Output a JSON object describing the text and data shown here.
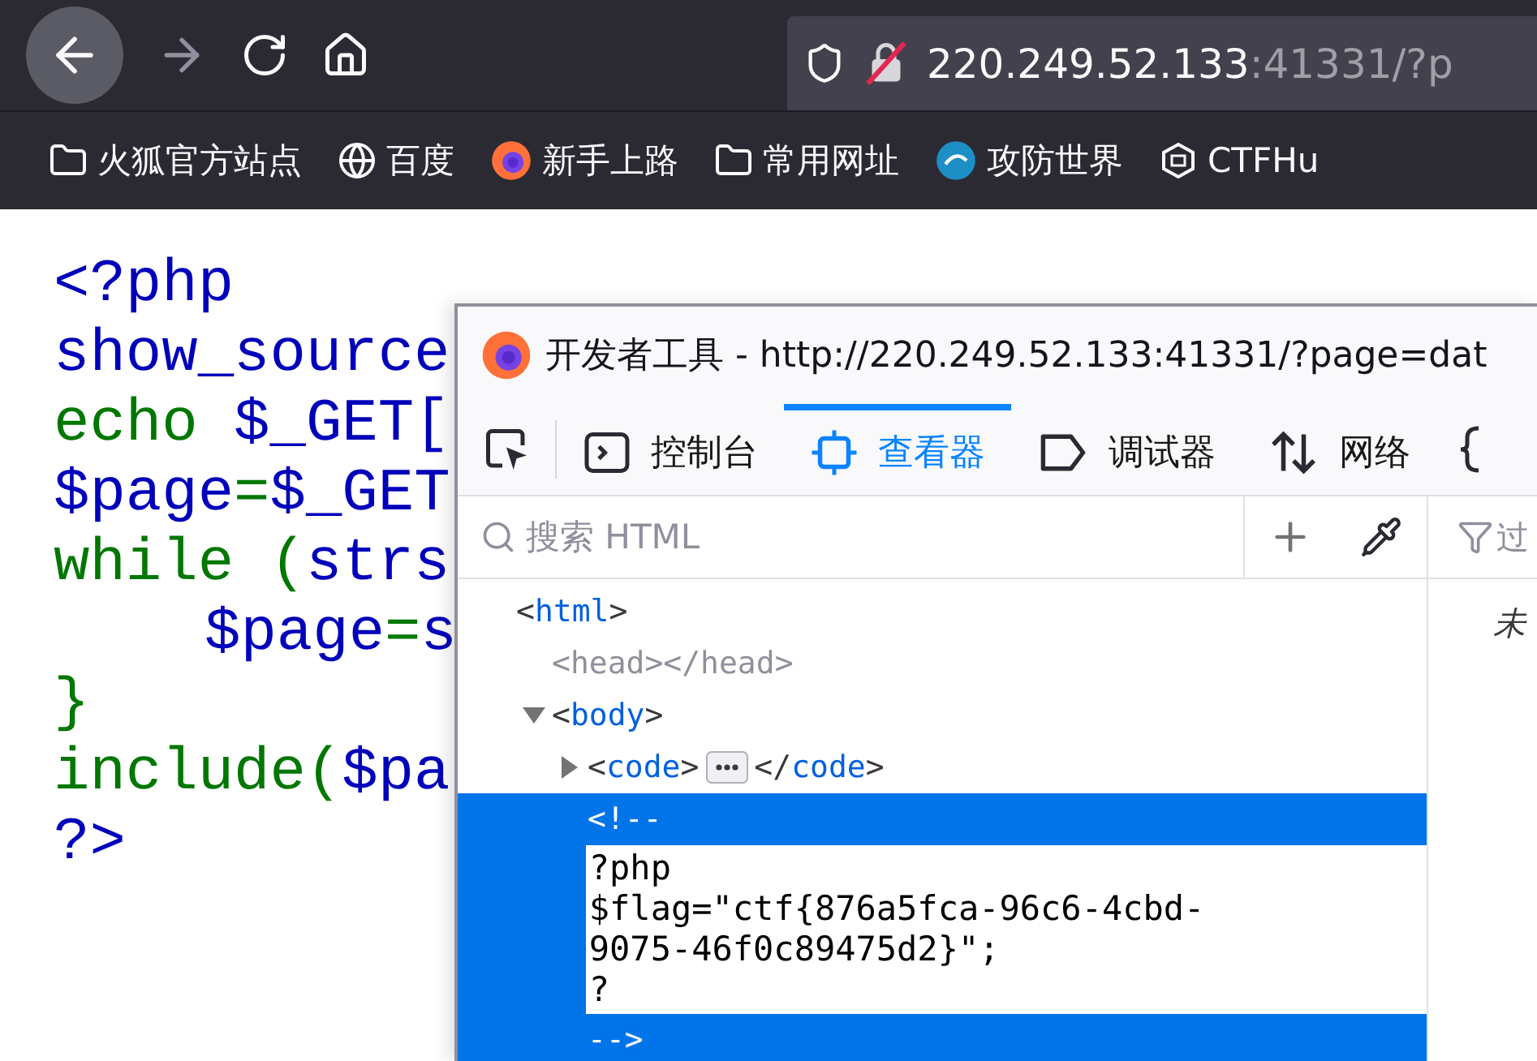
{
  "toolbar": {
    "url_host": "220.249.52.133",
    "url_rest": ":41331/?p"
  },
  "bookmarks": [
    {
      "kind": "folder",
      "label": "火狐官方站点"
    },
    {
      "kind": "globe",
      "label": "百度"
    },
    {
      "kind": "firefox",
      "label": "新手上路"
    },
    {
      "kind": "folder",
      "label": "常用网址"
    },
    {
      "kind": "badge",
      "label": "攻防世界"
    },
    {
      "kind": "hexagon",
      "label": "CTFHu"
    }
  ],
  "source_code": [
    {
      "segments": [
        {
          "text": "<?php",
          "kind": "default"
        }
      ]
    },
    {
      "segments": [
        {
          "text": "show_source",
          "kind": "default"
        }
      ]
    },
    {
      "segments": [
        {
          "text": "echo",
          "kind": "keyword"
        },
        {
          "text": " $_GET[",
          "kind": "default"
        }
      ]
    },
    {
      "segments": [
        {
          "text": "$page",
          "kind": "default"
        },
        {
          "text": "=",
          "kind": "keyword"
        },
        {
          "text": "$_GET",
          "kind": "default"
        }
      ]
    },
    {
      "segments": [
        {
          "text": "while (",
          "kind": "keyword"
        },
        {
          "text": "strs",
          "kind": "default"
        }
      ],
      "children": [
        {
          "segments": [
            {
              "text": "$page",
              "kind": "default"
            },
            {
              "text": "=",
              "kind": "keyword"
            },
            {
              "text": "s",
              "kind": "default"
            }
          ]
        }
      ]
    },
    {
      "segments": [
        {
          "text": "}",
          "kind": "keyword"
        }
      ]
    },
    {
      "segments": [
        {
          "text": "include(",
          "kind": "keyword"
        },
        {
          "text": "$pa",
          "kind": "default"
        }
      ]
    },
    {
      "segments": [
        {
          "text": "?>",
          "kind": "default"
        }
      ]
    }
  ],
  "devtools": {
    "title": "开发者工具 - http://220.249.52.133:41331/?page=dat",
    "tabs": [
      {
        "kind": "console",
        "label": "控制台",
        "selected": false
      },
      {
        "kind": "inspector",
        "label": "查看器",
        "selected": true
      },
      {
        "kind": "debugger",
        "label": "调试器",
        "selected": false
      },
      {
        "kind": "network",
        "label": "网络",
        "selected": false
      }
    ],
    "search": {
      "placeholder": "搜索 HTML"
    },
    "tree": [
      {
        "kind": "element",
        "open": "<html>",
        "children": [
          {
            "kind": "element",
            "open": "<head></head>",
            "dimmed": true
          },
          {
            "kind": "element",
            "open": "<body>",
            "expanded": true,
            "children": [
              {
                "kind": "element",
                "open": "<code>",
                "close": "</code>",
                "expanded": false
              },
              {
                "kind": "comment",
                "open": "<!--",
                "close": "-->",
                "selected": true,
                "editor_value": "?php\n$flag=\"ctf{876a5fca-96c6-4cbd-9075-46f0c89475d2}\";\n?"
              }
            ]
          }
        ]
      }
    ],
    "side_panel": {
      "filter_placeholder": "过",
      "text": "未"
    }
  }
}
